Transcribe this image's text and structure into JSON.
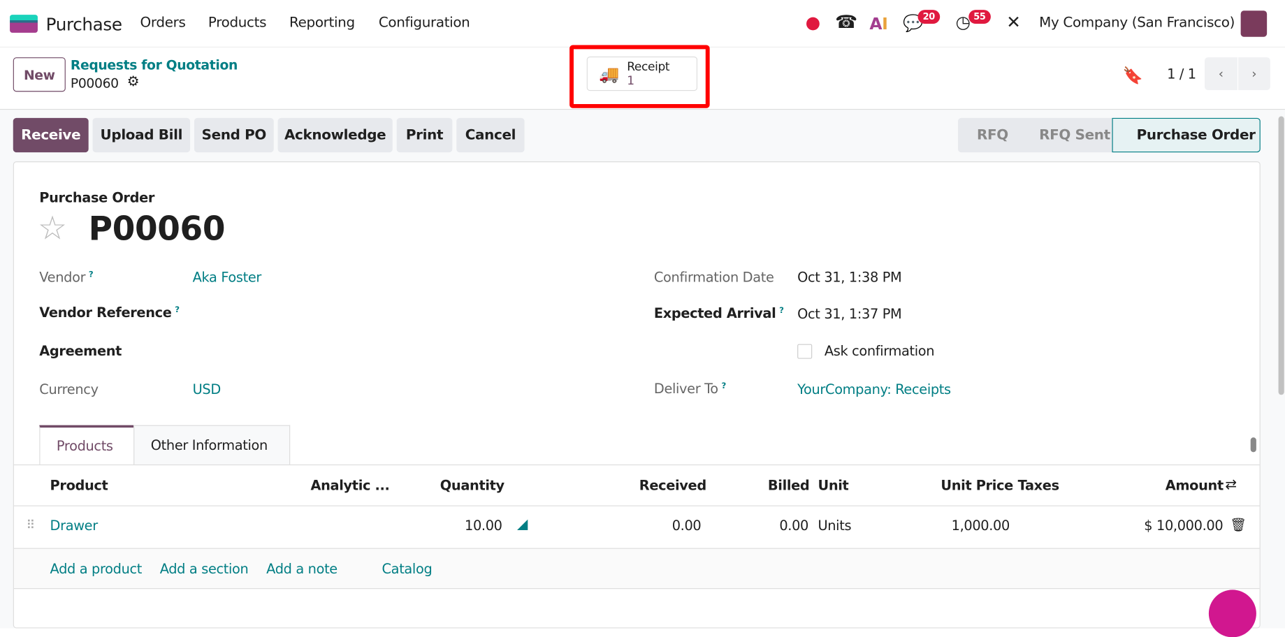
{
  "nav": {
    "app": "Purchase",
    "menu": [
      "Orders",
      "Products",
      "Reporting",
      "Configuration"
    ],
    "messages_count": "20",
    "activities_count": "55",
    "company": "My Company (San Francisco)"
  },
  "control": {
    "new_label": "New",
    "breadcrumb": "Requests for Quotation",
    "record": "P00060",
    "pager": "1 / 1"
  },
  "smart_button": {
    "label": "Receipt",
    "count": "1"
  },
  "actions": [
    "Receive",
    "Upload Bill",
    "Send PO",
    "Acknowledge",
    "Print",
    "Cancel"
  ],
  "statusbar": [
    "RFQ",
    "RFQ Sent",
    "Purchase Order"
  ],
  "form": {
    "type_label": "Purchase Order",
    "name": "P00060",
    "vendor_label": "Vendor",
    "vendor": "Aka Foster",
    "vendor_ref_label": "Vendor Reference",
    "agreement_label": "Agreement",
    "currency_label": "Currency",
    "currency": "USD",
    "confirmation_label": "Confirmation Date",
    "confirmation": "Oct 31, 1:38 PM",
    "arrival_label": "Expected Arrival",
    "arrival": "Oct 31, 1:37 PM",
    "ask_confirmation": "Ask confirmation",
    "deliver_label": "Deliver To",
    "deliver": "YourCompany: Receipts",
    "help": "?"
  },
  "tabs": [
    "Products",
    "Other Information"
  ],
  "table": {
    "headers": [
      "Product",
      "Analytic ...",
      "Quantity",
      "Received",
      "Billed",
      "Unit",
      "Unit Price",
      "Taxes",
      "Amount"
    ],
    "rows": [
      {
        "product": "Drawer",
        "quantity": "10.00",
        "received": "0.00",
        "billed": "0.00",
        "unit": "Units",
        "unit_price": "1,000.00",
        "taxes": "",
        "amount": "$ 10,000.00"
      }
    ],
    "add": [
      "Add a product",
      "Add a section",
      "Add a note",
      "Catalog"
    ]
  },
  "colors": {
    "brand": "#714b67",
    "link": "#017e84",
    "highlight": "#ff0000"
  }
}
